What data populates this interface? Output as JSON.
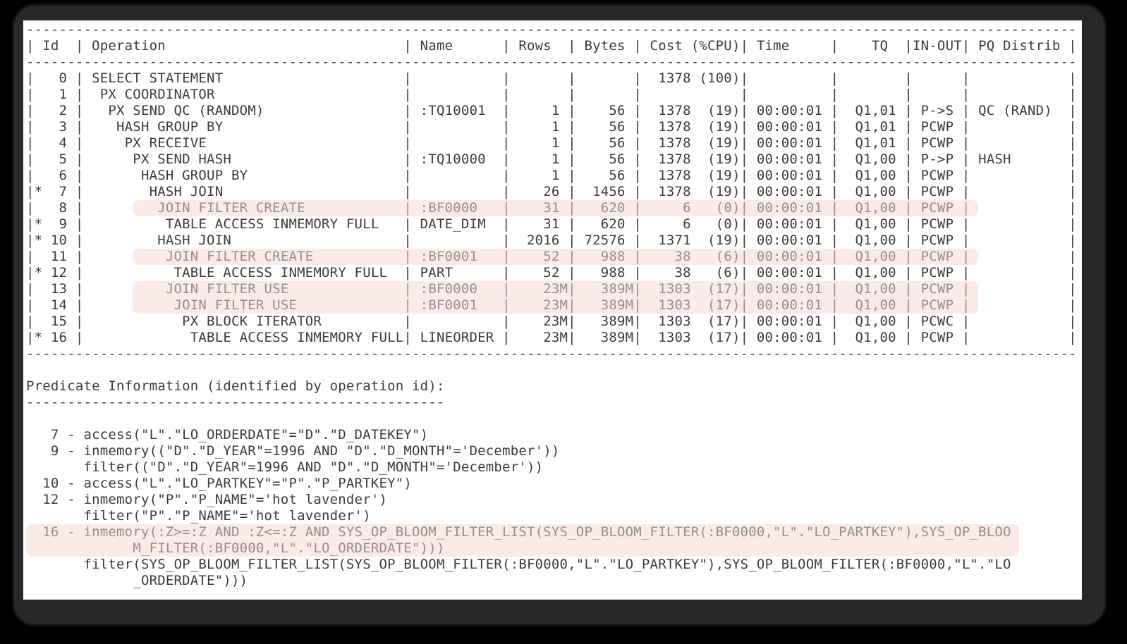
{
  "colors": {
    "background": "#000000",
    "window_shadow": "#282828",
    "panel_bg": "#ffffff",
    "text": "#3c3c3c",
    "highlight_bg": "#fbeae7",
    "highlight_text": "#948f8d"
  },
  "highlight": {
    "row_start": 13,
    "row_end": 116,
    "pred_start": 0,
    "pred_end": 121
  },
  "plan": {
    "line_width": 128,
    "columns": [
      "Id",
      "Operation",
      "Name",
      "Rows",
      "Bytes",
      "Cost (%CPU)",
      "Time",
      "TQ",
      "IN-OUT",
      "PQ Distrib"
    ],
    "header_cells": [
      " Id  ",
      " Operation                             ",
      " Name      ",
      " Rows  ",
      " Bytes ",
      " Cost (%CPU)",
      " Time     ",
      "    TQ  ",
      "IN-OUT",
      " PQ Distrib "
    ],
    "rows": [
      {
        "cells": [
          "   0 ",
          " SELECT STATEMENT                      ",
          "           ",
          "       ",
          "       ",
          "  1378 (100)",
          "          ",
          "        ",
          "      ",
          "            "
        ]
      },
      {
        "cells": [
          "   1 ",
          "  PX COORDINATOR                       ",
          "           ",
          "       ",
          "       ",
          "            ",
          "          ",
          "        ",
          "      ",
          "            "
        ]
      },
      {
        "cells": [
          "   2 ",
          "   PX SEND QC (RANDOM)                 ",
          " :TQ10001  ",
          "     1 ",
          "    56 ",
          "  1378  (19)",
          " 00:00:01 ",
          "  Q1,01 ",
          " P->S ",
          " QC (RAND)  "
        ]
      },
      {
        "cells": [
          "   3 ",
          "    HASH GROUP BY                      ",
          "           ",
          "     1 ",
          "    56 ",
          "  1378  (19)",
          " 00:00:01 ",
          "  Q1,01 ",
          " PCWP ",
          "            "
        ]
      },
      {
        "cells": [
          "   4 ",
          "     PX RECEIVE                        ",
          "           ",
          "     1 ",
          "    56 ",
          "  1378  (19)",
          " 00:00:01 ",
          "  Q1,01 ",
          " PCWP ",
          "            "
        ]
      },
      {
        "cells": [
          "   5 ",
          "      PX SEND HASH                     ",
          " :TQ10000  ",
          "     1 ",
          "    56 ",
          "  1378  (19)",
          " 00:00:01 ",
          "  Q1,00 ",
          " P->P ",
          " HASH       "
        ]
      },
      {
        "cells": [
          "   6 ",
          "       HASH GROUP BY                   ",
          "           ",
          "     1 ",
          "    56 ",
          "  1378  (19)",
          " 00:00:01 ",
          "  Q1,00 ",
          " PCWP ",
          "            "
        ]
      },
      {
        "cells": [
          "*  7 ",
          "        HASH JOIN                      ",
          "           ",
          "    26 ",
          "  1456 ",
          "  1378  (19)",
          " 00:00:01 ",
          "  Q1,00 ",
          " PCWP ",
          "            "
        ]
      },
      {
        "cells": [
          "   8 ",
          "         JOIN FILTER CREATE            ",
          " :BF0000   ",
          "    31 ",
          "   620 ",
          "     6   (0)",
          " 00:00:01 ",
          "  Q1,00 ",
          " PCWP ",
          "            "
        ],
        "hl": "solo"
      },
      {
        "cells": [
          "*  9 ",
          "          TABLE ACCESS INMEMORY FULL   ",
          " DATE_DIM  ",
          "    31 ",
          "   620 ",
          "     6   (0)",
          " 00:00:01 ",
          "  Q1,00 ",
          " PCWP ",
          "            "
        ]
      },
      {
        "cells": [
          "* 10 ",
          "         HASH JOIN                     ",
          "           ",
          "  2016 ",
          " 72576 ",
          "  1371  (19)",
          " 00:00:01 ",
          "  Q1,00 ",
          " PCWP ",
          "            "
        ]
      },
      {
        "cells": [
          "  11 ",
          "          JOIN FILTER CREATE           ",
          " :BF0001   ",
          "    52 ",
          "   988 ",
          "    38   (6)",
          " 00:00:01 ",
          "  Q1,00 ",
          " PCWP ",
          "            "
        ],
        "hl": "solo"
      },
      {
        "cells": [
          "* 12 ",
          "           TABLE ACCESS INMEMORY FULL  ",
          " PART      ",
          "    52 ",
          "   988 ",
          "    38   (6)",
          " 00:00:01 ",
          "  Q1,00 ",
          " PCWP ",
          "            "
        ]
      },
      {
        "cells": [
          "  13 ",
          "          JOIN FILTER USE              ",
          " :BF0000   ",
          "    23M",
          "   389M",
          "  1303  (17)",
          " 00:00:01 ",
          "  Q1,00 ",
          " PCWP ",
          "            "
        ],
        "hl": "top"
      },
      {
        "cells": [
          "  14 ",
          "           JOIN FILTER USE             ",
          " :BF0001   ",
          "    23M",
          "   389M",
          "  1303  (17)",
          " 00:00:01 ",
          "  Q1,00 ",
          " PCWP ",
          "            "
        ],
        "hl": "bottom"
      },
      {
        "cells": [
          "  15 ",
          "            PX BLOCK ITERATOR          ",
          "           ",
          "    23M",
          "   389M",
          "  1303  (17)",
          " 00:00:01 ",
          "  Q1,00 ",
          " PCWC ",
          "            "
        ]
      },
      {
        "cells": [
          "* 16 ",
          "             TABLE ACCESS INMEMORY FULL",
          " LINEORDER ",
          "    23M",
          "   389M",
          "  1303  (17)",
          " 00:00:01 ",
          "  Q1,00 ",
          " PCWP ",
          "            "
        ]
      }
    ]
  },
  "predicates": {
    "title": "Predicate Information (identified by operation id):",
    "lines": [
      {
        "text": "   7 - access(\"L\".\"LO_ORDERDATE\"=\"D\".\"D_DATEKEY\")"
      },
      {
        "text": "   9 - inmemory((\"D\".\"D_YEAR\"=1996 AND \"D\".\"D_MONTH\"='December'))"
      },
      {
        "text": "       filter((\"D\".\"D_YEAR\"=1996 AND \"D\".\"D_MONTH\"='December'))"
      },
      {
        "text": "  10 - access(\"L\".\"LO_PARTKEY\"=\"P\".\"P_PARTKEY\")"
      },
      {
        "text": "  12 - inmemory(\"P\".\"P_NAME\"='hot lavender')"
      },
      {
        "text": "       filter(\"P\".\"P_NAME\"='hot lavender')"
      },
      {
        "text": "  16 - inmemory(:Z>=:Z AND :Z<=:Z AND SYS_OP_BLOOM_FILTER_LIST(SYS_OP_BLOOM_FILTER(:BF0000,\"L\".\"LO_PARTKEY\"),SYS_OP_BLOO",
        "hl": "top"
      },
      {
        "text": "             M_FILTER(:BF0000,\"L\".\"LO_ORDERDATE\")))",
        "hl": "bottom"
      },
      {
        "text": "       filter(SYS_OP_BLOOM_FILTER_LIST(SYS_OP_BLOOM_FILTER(:BF0000,\"L\".\"LO_PARTKEY\"),SYS_OP_BLOOM_FILTER(:BF0000,\"L\".\"LO"
      },
      {
        "text": "             _ORDERDATE\")))"
      }
    ]
  }
}
